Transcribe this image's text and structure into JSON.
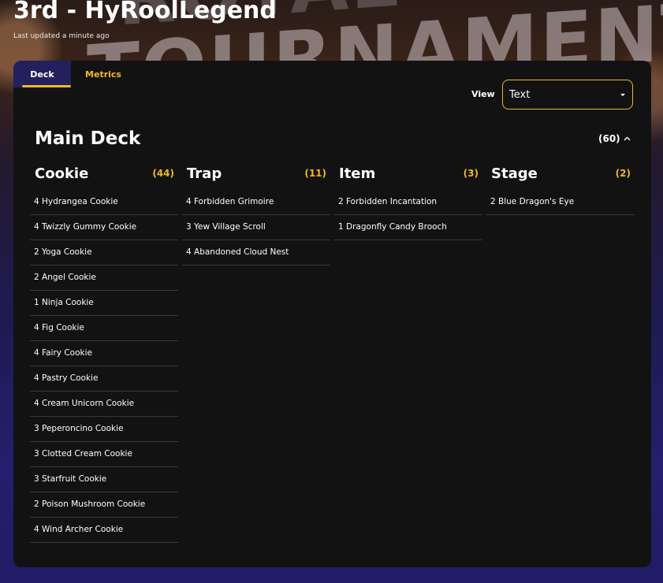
{
  "header": {
    "title": "3rd - HyRoolLegend",
    "last_updated": "Last updated a minute ago"
  },
  "tabs": [
    {
      "label": "Deck",
      "active": true
    },
    {
      "label": "Metrics",
      "active": false
    }
  ],
  "view": {
    "label": "View",
    "selected": "Text"
  },
  "main_deck": {
    "title": "Main Deck",
    "count": "(60)",
    "collapse_icon": "chevron-up-icon"
  },
  "categories": [
    {
      "name": "Cookie",
      "count": "(44)",
      "items": [
        "4 Hydrangea Cookie",
        "4 Twizzly Gummy Cookie",
        "2 Yoga Cookie",
        "2 Angel Cookie",
        "1 Ninja Cookie",
        "4 Fig Cookie",
        "4 Fairy Cookie",
        "4 Pastry Cookie",
        "4 Cream Unicorn Cookie",
        "3 Peperoncino Cookie",
        "3 Clotted Cream Cookie",
        "3 Starfruit Cookie",
        "2 Poison Mushroom Cookie",
        "4 Wind Archer Cookie"
      ]
    },
    {
      "name": "Trap",
      "count": "(11)",
      "items": [
        "4 Forbidden Grimoire",
        "3 Yew Village Scroll",
        "4 Abandoned Cloud Nest"
      ]
    },
    {
      "name": "Item",
      "count": "(3)",
      "items": [
        "2 Forbidden Incantation",
        "1 Dragonfly Candy Brooch"
      ]
    },
    {
      "name": "Stage",
      "count": "(2)",
      "items": [
        "2 Blue Dragon's Eye"
      ]
    }
  ],
  "colors": {
    "accent": "#f2b81c",
    "panel": "#121212",
    "active_tab": "#23205e",
    "divider": "#3a3a3a"
  }
}
